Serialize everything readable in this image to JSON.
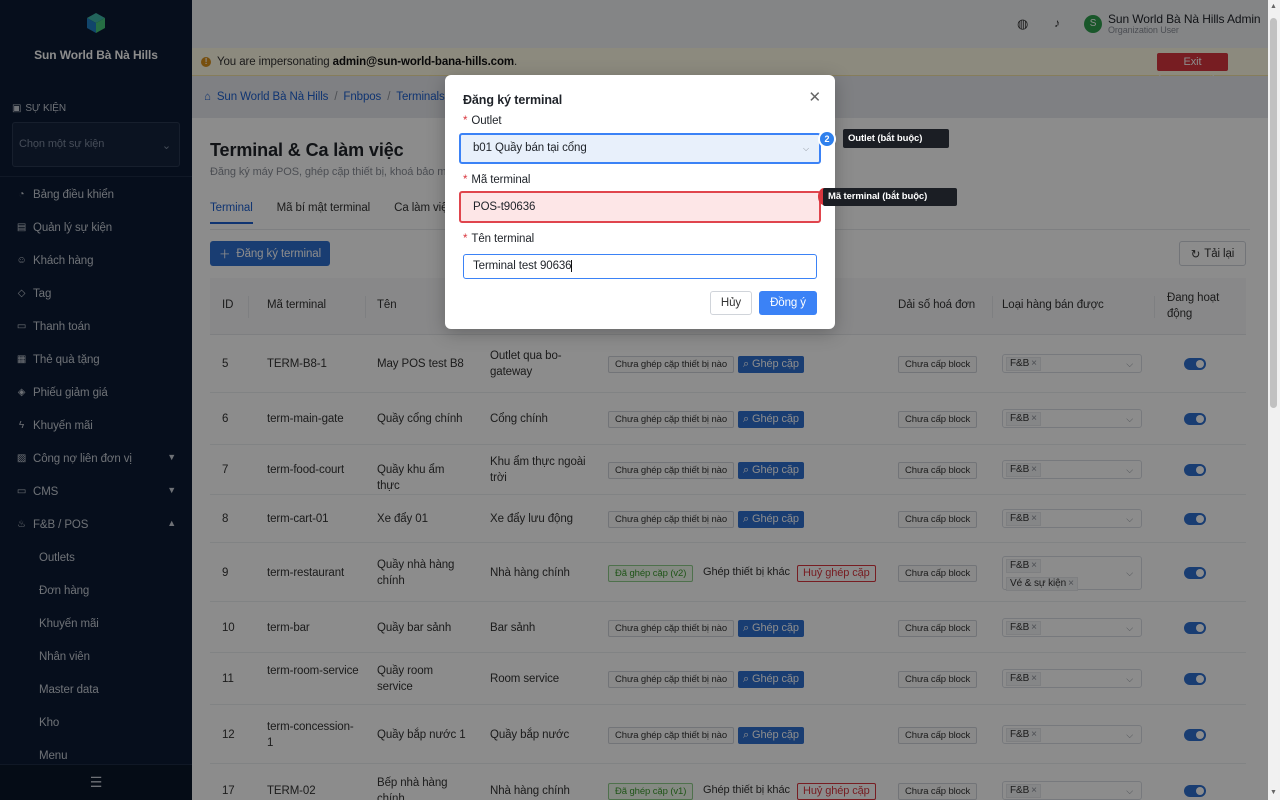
{
  "sidebar": {
    "org_name": "Sun World Bà Nà Hills",
    "org_sub": "",
    "event_section_label": "SỰ KIỆN",
    "event_placeholder": "Chọn một sự kiện",
    "items": [
      {
        "label": "Bảng điều khiển",
        "icon": "dashboard-icon"
      },
      {
        "label": "Quản lý sự kiện",
        "icon": "calendar-icon"
      },
      {
        "label": "Khách hàng",
        "icon": "users-icon"
      },
      {
        "label": "Tag",
        "icon": "tag-icon"
      },
      {
        "label": "Thanh toán",
        "icon": "payment-icon"
      },
      {
        "label": "Thẻ quà tặng",
        "icon": "gift-icon"
      },
      {
        "label": "Phiếu giảm giá",
        "icon": "coupon-icon"
      },
      {
        "label": "Khuyến mãi",
        "icon": "promo-icon"
      },
      {
        "label": "Công nợ liên đơn vị",
        "icon": "debt-icon"
      },
      {
        "label": "CMS",
        "icon": "cms-icon"
      },
      {
        "label": "F&B / POS",
        "icon": "fnb-icon"
      }
    ],
    "sub_items": [
      "Outlets",
      "Đơn hàng",
      "Khuyến mãi",
      "Nhân viên",
      "Master data",
      "Kho",
      "Menu"
    ]
  },
  "topbar": {
    "user_name": "Sun World Bà Nà Hills Admin",
    "user_role": "Organization User",
    "avatar_letter": "S"
  },
  "impersonation": {
    "prefix": "You are impersonating ",
    "email": "admin@sun-world-bana-hills.com",
    "suffix": ".",
    "exit_label": "Exit impersonation"
  },
  "breadcrumb": [
    "Sun World Bà Nà Hills",
    "Fnbpos",
    "Terminals"
  ],
  "page": {
    "title": "Terminal & Ca làm việc",
    "subtitle": "Đăng ký máy POS, ghép cặp thiết bị, khoá bảo mật",
    "tabs": [
      "Terminal",
      "Mã bí mật terminal",
      "Ca làm việc"
    ],
    "add_label": "Đăng ký terminal",
    "reload_label": "Tải lại"
  },
  "table": {
    "headers": [
      "ID",
      "Mã terminal",
      "Tên",
      "Dải số hoá đơn",
      "Loại hàng bán được",
      "Đang hoạt động"
    ],
    "rows": [
      {
        "id": "5",
        "code": "TERM-B8-1",
        "name": "May POS test B8",
        "outlet": "Outlet qua bo-gateway",
        "status": "Chưa ghép cặp thiết bị nào",
        "invoice": "Chưa cấp block",
        "cats": [
          "F&B"
        ]
      },
      {
        "id": "6",
        "code": "term-main-gate",
        "name": "Quầy cổng chính",
        "outlet": "Cổng chính",
        "status": "Chưa ghép cặp thiết bị nào",
        "invoice": "Chưa cấp block",
        "cats": [
          "F&B"
        ]
      },
      {
        "id": "7",
        "code": "term-food-court",
        "name": "Quầy khu ẩm thực",
        "outlet": "Khu ẩm thực ngoài trời",
        "status": "Chưa ghép cặp thiết bị nào",
        "invoice": "Chưa cấp block",
        "cats": [
          "F&B"
        ]
      },
      {
        "id": "8",
        "code": "term-cart-01",
        "name": "Xe đẩy 01",
        "outlet": "Xe đẩy lưu động",
        "status": "Chưa ghép cặp thiết bị nào",
        "invoice": "Chưa cấp block",
        "cats": [
          "F&B"
        ]
      },
      {
        "id": "9",
        "code": "term-restaurant",
        "name": "Quầy nhà hàng chính",
        "outlet": "Nhà hàng chính",
        "status": "Đã ghép cặp (v2)",
        "invoice": "Chưa cấp block",
        "cats": [
          "F&B",
          "Vé & sự kiện"
        ]
      },
      {
        "id": "10",
        "code": "term-bar",
        "name": "Quầy bar sảnh",
        "outlet": "Bar sảnh",
        "status": "Chưa ghép cặp thiết bị nào",
        "invoice": "Chưa cấp block",
        "cats": [
          "F&B"
        ]
      },
      {
        "id": "11",
        "code": "term-room-service",
        "name": "Quầy room service",
        "outlet": "Room service",
        "status": "Chưa ghép cặp thiết bị nào",
        "invoice": "Chưa cấp block",
        "cats": [
          "F&B"
        ]
      },
      {
        "id": "12",
        "code": "term-concession-1",
        "name": "Quầy bắp nước 1",
        "outlet": "Quầy bắp nước",
        "status": "Chưa ghép cặp thiết bị nào",
        "invoice": "Chưa cấp block",
        "cats": [
          "F&B"
        ]
      },
      {
        "id": "17",
        "code": "TERM-02",
        "name": "Bếp nhà hàng chính",
        "outlet": "Nhà hàng chính",
        "status": "Đã ghép cặp (v1)",
        "invoice": "Chưa cấp block",
        "cats": [
          "F&B"
        ]
      }
    ],
    "pair_label": "Ghép cặp",
    "pair_other_label": "Ghép thiết bị khác",
    "unpair_label": "Huỷ ghép cặp"
  },
  "modal": {
    "title": "Đăng ký terminal",
    "outlet_label": "Outlet",
    "outlet_value": "b01 Quầy bán tại cổng",
    "code_label": "Mã terminal",
    "code_value": "POS-t90636",
    "name_label": "Tên terminal",
    "name_value": "Terminal test 90636",
    "cancel_label": "Hủy",
    "ok_label": "Đồng ý"
  },
  "annotations": {
    "badge_number": "2",
    "tip_outlet": "Outlet (bắt buộc)",
    "tip_code": "Mã terminal (bắt buộc)"
  },
  "colors": {
    "primary": "#2f6fd0",
    "danger": "#d9363e",
    "sidebar": "#0c1b33"
  }
}
